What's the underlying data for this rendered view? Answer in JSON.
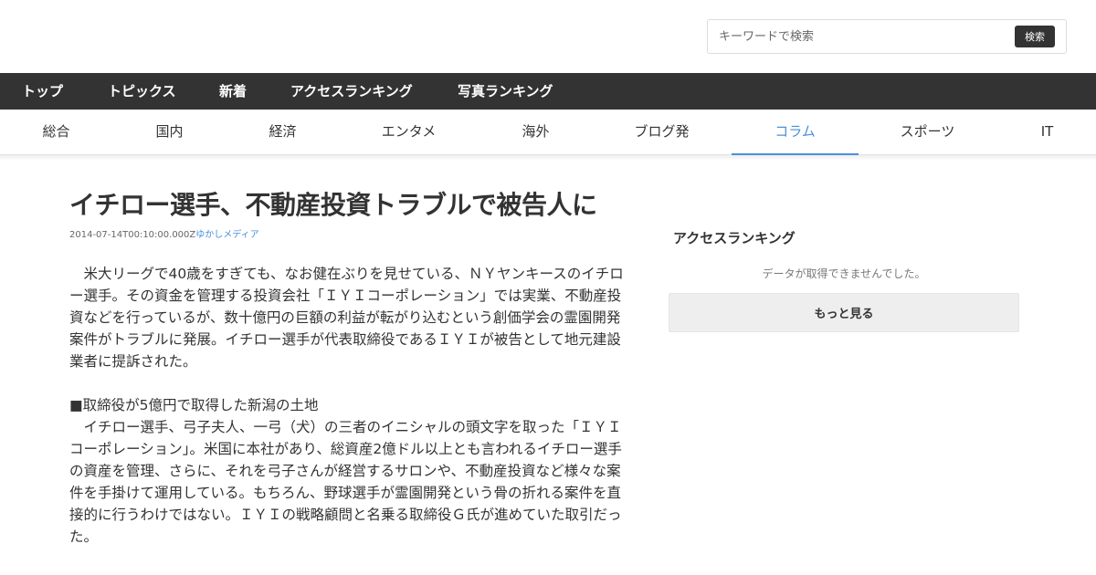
{
  "search": {
    "placeholder": "キーワードで検索",
    "button_label": "検索"
  },
  "top_nav": {
    "items": [
      "トップ",
      "トピックス",
      "新着",
      "アクセスランキング",
      "写真ランキング"
    ]
  },
  "category_nav": {
    "items": [
      "総合",
      "国内",
      "経済",
      "エンタメ",
      "海外",
      "ブログ発",
      "コラム",
      "スポーツ",
      "IT"
    ],
    "active": "コラム"
  },
  "article": {
    "title": "イチロー選手、不動産投資トラブルで被告人に",
    "timestamp": "2014-07-14T00:10:00.000Z",
    "source": "ゆかしメディア",
    "paragraphs": [
      "　米大リーグで40歳をすぎても、なお健在ぶりを見せている、ＮＹヤンキースのイチロー選手。その資金を管理する投資会社「ＩＹＩコーポレーション」では実業、不動産投資などを行っているが、数十億円の巨額の利益が転がり込むという創価学会の霊園開発案件がトラブルに発展。イチロー選手が代表取締役であるＩＹＩが被告として地元建設業者に提訴された。",
      "■取締役が5億円で取得した新潟の土地\n　イチロー選手、弓子夫人、一弓（犬）の三者のイニシャルの頭文字を取った「ＩＹＩコーポレーション」。米国に本社があり、総資産2億ドル以上とも言われるイチロー選手の資産を管理、さらに、それを弓子さんが経営するサロンや、不動産投資など様々な案件を手掛けて運用している。もちろん、野球選手が霊園開発という骨の折れる案件を直接的に行うわけではない。ＩＹＩの戦略顧問と名乗る取締役Ｇ氏が進めていた取引だった。"
    ]
  },
  "sidebar": {
    "ranking_title": "アクセスランキング",
    "empty_message": "データが取得できませんでした。",
    "more_label": "もっと見る"
  },
  "colors": {
    "accent": "#4a90d9",
    "nav_bg": "#333333"
  }
}
